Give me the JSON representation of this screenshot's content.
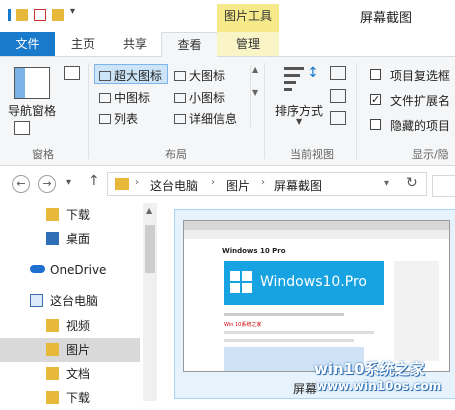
{
  "window": {
    "title": "屏幕截图",
    "context_tab": "图片工具"
  },
  "tabs": [
    {
      "label": "文件"
    },
    {
      "label": "主页"
    },
    {
      "label": "共享"
    },
    {
      "label": "查看"
    },
    {
      "label": "管理"
    }
  ],
  "ribbon": {
    "pane": {
      "nav_pane_label": "导航窗格",
      "group_label": "窗格"
    },
    "layout": {
      "items": [
        "超大图标",
        "大图标",
        "中图标",
        "小图标",
        "列表",
        "详细信息"
      ],
      "selected": "超大图标",
      "group_label": "布局"
    },
    "current_view": {
      "sort_label": "排序方式",
      "group_label": "当前视图"
    },
    "show_hide": {
      "item_checkboxes": {
        "label": "项目复选框",
        "checked": false
      },
      "file_extensions": {
        "label": "文件扩展名",
        "checked": true
      },
      "hidden_items": {
        "label": "隐藏的项目",
        "checked": false
      },
      "group_label": "显示/隐"
    }
  },
  "address": {
    "crumbs": [
      "这台电脑",
      "图片",
      "屏幕截图"
    ]
  },
  "nav_pane": {
    "items": [
      "下载",
      "桌面",
      "OneDrive",
      "这台电脑",
      "视频",
      "图片",
      "文档",
      "下载"
    ],
    "selected": "图片"
  },
  "content": {
    "file_label": "屏幕",
    "preview": {
      "heading": "Windows 10 Pro",
      "banner_text": "Windows10.Pro",
      "link_text": "Win 10系统之家"
    }
  },
  "watermark": {
    "line1": "win10系统之家",
    "line2": "www.win10os.com"
  },
  "colors": {
    "accent": "#1979ca",
    "context_tab": "#f5e98a",
    "folder": "#e8b83b",
    "onedrive": "#1e6fd0"
  }
}
